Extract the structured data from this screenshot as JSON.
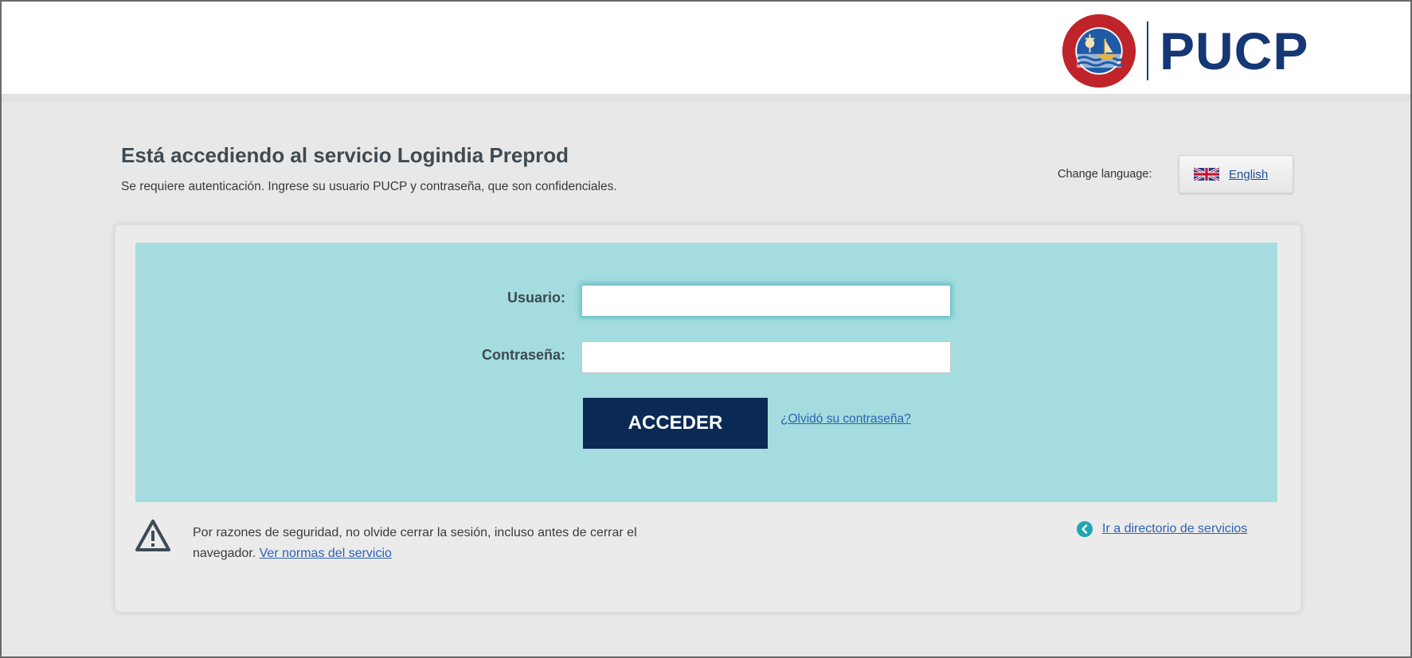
{
  "header": {
    "logo_text": "PUCP",
    "seal_text": "ET LUX IN TENEBRIS LUCET"
  },
  "page": {
    "title": "Está accediendo al servicio Logindia Preprod",
    "subtitle": "Se requiere autenticación. Ingrese su usuario PUCP y contraseña, que son confidenciales."
  },
  "language": {
    "label": "Change language:",
    "link": "English",
    "flag_icon": "uk-flag-icon"
  },
  "form": {
    "username_label": "Usuario:",
    "username_value": "",
    "password_label": "Contraseña:",
    "password_value": "",
    "submit_label": "ACCEDER",
    "forgot_link": "¿Olvidó su contraseña?"
  },
  "footer": {
    "notice_text": "Por razones de seguridad, no olvide cerrar la sesión, incluso antes de cerrar el navegador.",
    "notice_link": "Ver normas del servicio",
    "directory_link": "Ir a directorio de servicios",
    "warning_icon": "warning-icon",
    "directory_icon": "chevron-left-circle-icon"
  },
  "colors": {
    "brand_navy": "#163775",
    "button_navy": "#0a2a55",
    "panel_teal": "#a4dcdf",
    "link_blue": "#2b63b3",
    "icon_teal": "#1fa6b0"
  }
}
